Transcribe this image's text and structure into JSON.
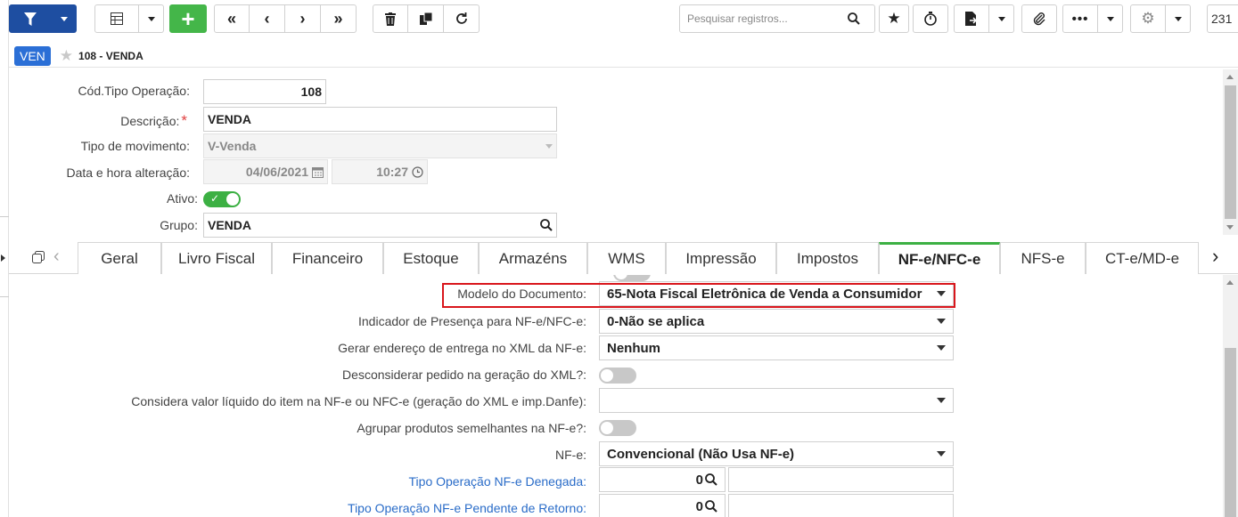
{
  "toolbar": {
    "search_placeholder": "Pesquisar registros...",
    "record_count": "231",
    "icons": [
      "filter-icon",
      "grid-icon",
      "add-icon",
      "first-icon",
      "prev-icon",
      "next-icon",
      "last-icon",
      "trash-icon",
      "copy-icon",
      "refresh-icon",
      "search-icon",
      "star-icon",
      "timer-icon",
      "export-icon",
      "clip-icon",
      "more-icon",
      "gear-icon"
    ]
  },
  "header": {
    "badge": "VEN",
    "title": "108 - VENDA"
  },
  "form": {
    "cod_label": "Cód.Tipo Operação:",
    "cod_value": "108",
    "desc_label": "Descrição:",
    "desc_required": "*",
    "desc_value": "VENDA",
    "tipo_label": "Tipo de movimento:",
    "tipo_value": "V-Venda",
    "data_label": "Data e hora alteração:",
    "data_value": "04/06/2021",
    "hora_value": "10:27",
    "ativo_label": "Ativo:",
    "grupo_label": "Grupo:",
    "grupo_value": "VENDA"
  },
  "tabs": [
    {
      "label": "Geral"
    },
    {
      "label": "Livro Fiscal"
    },
    {
      "label": "Financeiro"
    },
    {
      "label": "Estoque"
    },
    {
      "label": "Armazéns"
    },
    {
      "label": "WMS"
    },
    {
      "label": "Impressão"
    },
    {
      "label": "Impostos"
    },
    {
      "label": "NF-e/NFC-e"
    },
    {
      "label": "NFS-e"
    },
    {
      "label": "CT-e/MD-e"
    }
  ],
  "active_tab": "NF-e/NFC-e",
  "nfe": {
    "modelo_label": "Modelo do Documento:",
    "modelo_value": "65-Nota Fiscal Eletrônica de Venda a Consumidor",
    "presenca_label": "Indicador de Presença para NF-e/NFC-e:",
    "presenca_value": "0-Não se aplica",
    "endereco_label": "Gerar endereço de entrega no XML da NF-e:",
    "endereco_value": "Nenhum",
    "desconsiderar_label": "Desconsiderar pedido na geração do XML?:",
    "considera_label": "Considera valor líquido do item na NF-e ou NFC-e (geração do XML e imp.Danfe):",
    "considera_value": "",
    "agrupar_label": "Agrupar produtos semelhantes na NF-e?:",
    "nfe_label": "NF-e:",
    "nfe_value": "Convencional (Não Usa NF-e)",
    "denegada_label": "Tipo Operação NF-e Denegada:",
    "denegada_value": "0",
    "pendente_label": "Tipo Operação NF-e Pendente de Retorno:",
    "pendente_value": "0"
  },
  "colors": {
    "accent_blue": "#1e4ea1",
    "add_green": "#44b649",
    "active_tab": "#3cb043",
    "highlight_red": "#d9161c",
    "link_blue": "#2a6cc8"
  }
}
